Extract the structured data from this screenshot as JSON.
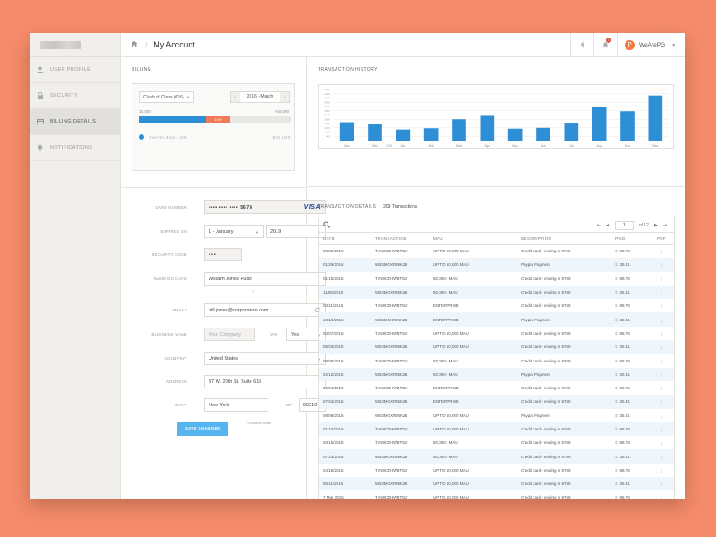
{
  "colors": {
    "accent": "#2f8fd6",
    "background": "#f58b6a",
    "usage_orange": "#f07a5a",
    "save_button": "#56b4ee"
  },
  "sidebar": {
    "items": [
      {
        "label": "User Profile",
        "icon": "user-icon"
      },
      {
        "label": "Security",
        "icon": "lock-icon"
      },
      {
        "label": "Billing Details",
        "icon": "credit-card-icon",
        "active": true
      },
      {
        "label": "Notifications",
        "icon": "bell-icon"
      }
    ]
  },
  "header": {
    "title": "My Account",
    "separator": "/",
    "user_name": "WeArePG",
    "avatar_letter": "P",
    "notification_count": "4"
  },
  "billing": {
    "section_title": "Billing",
    "plan_select": "Clash of Clans (iOS)",
    "period": "2016 - March",
    "limit_left": "10,000",
    "limit_right": "+50,000",
    "usage_percent": 0.44,
    "overage_percent": 0.16,
    "overage_label": "16%",
    "current_mau_label": "Current MAU - 42K",
    "price_label": "$49 USD",
    "form": {
      "card_number_label": "Card Number",
      "card_number": "•••• •••• •••• 5678",
      "card_brand": "VISA",
      "expires_label": "Expires On",
      "expires_month": "1 - January",
      "expires_year": "2019",
      "cvc_label": "Security Code",
      "cvc": "•••",
      "name_label": "Name On Card",
      "name": "William Jones Rudd",
      "email_label": "Email*",
      "email": "bill.jones@corporation.com",
      "business_label": "Business Name",
      "business_placeholder": "Your Company",
      "vat_label": "VAT",
      "vat": "Yes",
      "country_label": "Country*",
      "country": "United States",
      "address_label": "Address",
      "address": "37 W. 20th St. Suite 615",
      "city_label": "City*",
      "city": "New York",
      "zip_label": "ZIP",
      "zip": "90210",
      "required_note": "*Optional fields",
      "save_label": "Save Changes"
    }
  },
  "history": {
    "section_title": "Transaction History",
    "chart_data": {
      "type": "bar",
      "categories": [
        "Nov",
        "Dec",
        "Jan",
        "Feb",
        "Mar",
        "Apr",
        "May",
        "Jun",
        "Jul",
        "Aug",
        "Nov",
        "Dec"
      ],
      "year_marker": "2016",
      "values": [
        4.3,
        3.9,
        2.6,
        2.9,
        5.0,
        5.8,
        2.8,
        3.0,
        4.2,
        8.0,
        6.9,
        10.6
      ],
      "ytick_labels": [
        "400",
        "800",
        "1200",
        "1600",
        "2000",
        "2400",
        "2800",
        "3200",
        "3600",
        "4000",
        "4400",
        "4800"
      ],
      "ylim": [
        0,
        12
      ],
      "grid": true
    }
  },
  "details": {
    "section_title": "Transaction Details",
    "count": "209 Transactions",
    "page": "1",
    "of_pages": "of 12",
    "columns": [
      "Date",
      "Transaction",
      "MAU",
      "Description",
      "Paid",
      "PDF"
    ],
    "rows": [
      [
        "09/22/2016",
        "T4N8CZHWBTDV",
        "UP TO 50,000 MAU",
        "Credit card - ending in 8769",
        "88.78"
      ],
      [
        "01/29/2016",
        "WB3MGXRJ6KZ6",
        "UP TO 50,000 MAU",
        "Paypal Payment",
        "35.31"
      ],
      [
        "01/10/2016",
        "T4N8CZHWBTDV",
        "50,000+ MAU",
        "Credit card - ending in 8769",
        "88.78"
      ],
      [
        "11/06/2016",
        "WB3MGXRJ6KZ6",
        "50,000+ MAU",
        "Credit card - ending in 8769",
        "35.31"
      ],
      [
        "03/11/2016",
        "T4N8CZHWBTDV",
        "ENTERPRISE",
        "Credit card - ending in 8769",
        "88.78"
      ],
      [
        "10/18/2016",
        "WB3MGXRJ6KZ6",
        "ENTERPRISE",
        "Paypal Payment",
        "35.31"
      ],
      [
        "03/07/2016",
        "T4N8CZHWBTDV",
        "UP TO 50,000 MAU",
        "Credit card - ending in 8769",
        "88.78"
      ],
      [
        "05/03/2016",
        "WB3MGXRJ6KZ6",
        "UP TO 50,000 MAU",
        "Credit card - ending in 8769",
        "35.31"
      ],
      [
        "08/08/2016",
        "T4N8CZHWBTDV",
        "50,000+ MAU",
        "Credit card - ending in 8769",
        "88.78"
      ],
      [
        "02/12/2016",
        "WB3MGXRJ6KZ6",
        "50,000+ MAU",
        "Paypal Payment",
        "35.31"
      ],
      [
        "06/04/2016",
        "T4N8CZHWBTDV",
        "ENTERPRISE",
        "Credit card - ending in 8769",
        "88.78"
      ],
      [
        "07/04/2016",
        "WB3MGXRJ6KZ6",
        "ENTERPRISE",
        "Credit card - ending in 8769",
        "35.31"
      ],
      [
        "08/08/2016",
        "WB3MGXRJ6KZ6",
        "UP TO 50,000 MAU",
        "Paypal Payment",
        "35.31"
      ],
      [
        "01/10/2016",
        "T4N8CZHWBTDV",
        "UP TO 50,000 MAU",
        "Credit card - ending in 8769",
        "88.78"
      ],
      [
        "03/15/2016",
        "T4N8CZHWBTDV",
        "50,000+ MAU",
        "Credit card - ending in 8769",
        "88.78"
      ],
      [
        "07/23/2016",
        "WB3MGXRJ6KZ6",
        "50,000+ MAU",
        "Credit card - ending in 8769",
        "35.31"
      ],
      [
        "04/18/2016",
        "T4N8CZHWBTDV",
        "UP TO 50,000 MAU",
        "Credit card - ending in 8769",
        "88.78"
      ],
      [
        "06/11/2016",
        "WB3MGXRJ6KZ6",
        "UP TO 50,000 MAU",
        "Credit card - ending in 8769",
        "35.31"
      ],
      [
        "7 Mar 2015",
        "T4N8CZHWBTDV",
        "UP TO 50,000 MAU",
        "Credit card - ending in 8769",
        "88.78"
      ]
    ]
  }
}
